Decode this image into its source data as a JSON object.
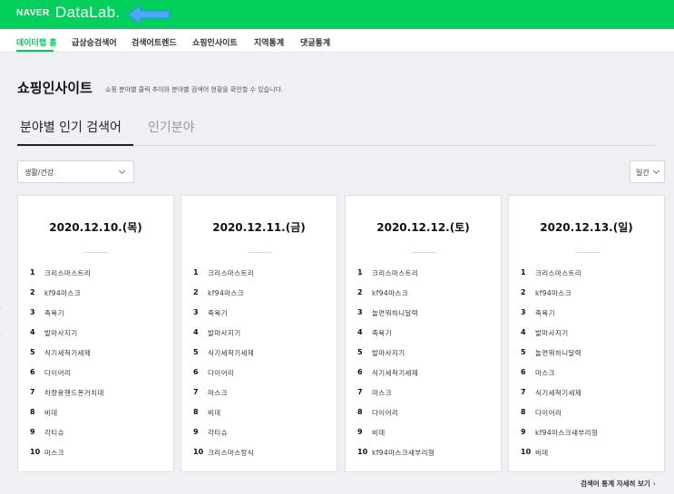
{
  "header": {
    "naver": "NAVER",
    "datalab": "DataLab.",
    "colors": {
      "bar": "#03cf5d",
      "arrow": "#4aa8ff"
    }
  },
  "nav": {
    "items": [
      "데이터랩 홈",
      "급상승검색어",
      "검색어트렌드",
      "쇼핑인사이트",
      "지역통계",
      "댓글통계"
    ],
    "active_index": 0
  },
  "page": {
    "title": "쇼핑인사이트",
    "description": "쇼핑 분야별 클릭 추이와 분야별 검색어 현황을 확인할 수 있습니다."
  },
  "subtabs": [
    "분야별 인기 검색어",
    "인기분야"
  ],
  "filters": {
    "category": "생활/건강",
    "period": "일간"
  },
  "cards": [
    {
      "date": "2020.12.10.(목)",
      "ranks": [
        "크리스마스트리",
        "kf94마스크",
        "족욕기",
        "발마사지기",
        "식기세척기세제",
        "다이어리",
        "차량용핸드폰거치대",
        "비데",
        "각티슈",
        "마스크"
      ]
    },
    {
      "date": "2020.12.11.(금)",
      "ranks": [
        "크리스마스트리",
        "kf94마스크",
        "족욕기",
        "발마사지기",
        "식기세척기세제",
        "다이어리",
        "마스크",
        "비데",
        "각티슈",
        "크리스마스장식"
      ]
    },
    {
      "date": "2020.12.12.(토)",
      "ranks": [
        "크리스마스트리",
        "kf94마스크",
        "놀면뭐하니달력",
        "족욕기",
        "발마사지기",
        "식기세척기세제",
        "마스크",
        "다이어리",
        "비데",
        "kf94마스크새부리형"
      ]
    },
    {
      "date": "2020.12.13.(일)",
      "ranks": [
        "크리스마스트리",
        "kf94마스크",
        "족욕기",
        "발마사지기",
        "놀면뭐하니달력",
        "마스크",
        "식기세척기세제",
        "다이어리",
        "kf94마스크새부리형",
        "비데"
      ]
    }
  ],
  "rank_numbers": [
    "1",
    "2",
    "3",
    "4",
    "5",
    "6",
    "7",
    "8",
    "9",
    "10"
  ],
  "footer": {
    "more_label": "검색어 통계 자세히 보기",
    "more_chevron": "›"
  }
}
